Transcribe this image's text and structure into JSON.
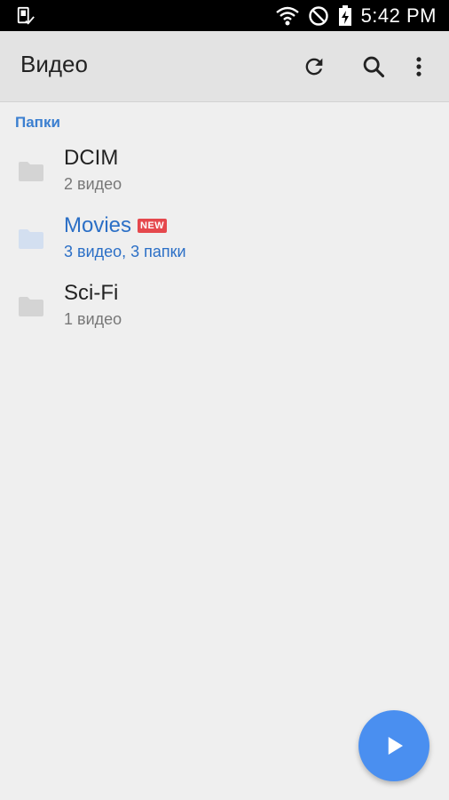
{
  "status_bar": {
    "time": "5:42 PM"
  },
  "app_bar": {
    "title": "Видео",
    "actions": [
      "refresh-icon",
      "search-icon",
      "more-vert-icon"
    ]
  },
  "section": {
    "header": "Папки"
  },
  "folders": [
    {
      "name": "DCIM",
      "subtitle": "2 видео",
      "badge": ""
    },
    {
      "name": "Movies",
      "subtitle": "3 видео, 3 папки",
      "badge": "NEW"
    },
    {
      "name": "Sci-Fi",
      "subtitle": "1 видео",
      "badge": ""
    }
  ],
  "colors": {
    "accent": "#3b7fd0",
    "highlight": "#2b6fc6",
    "badge": "#e5484d",
    "fab": "#4a8ff0"
  }
}
